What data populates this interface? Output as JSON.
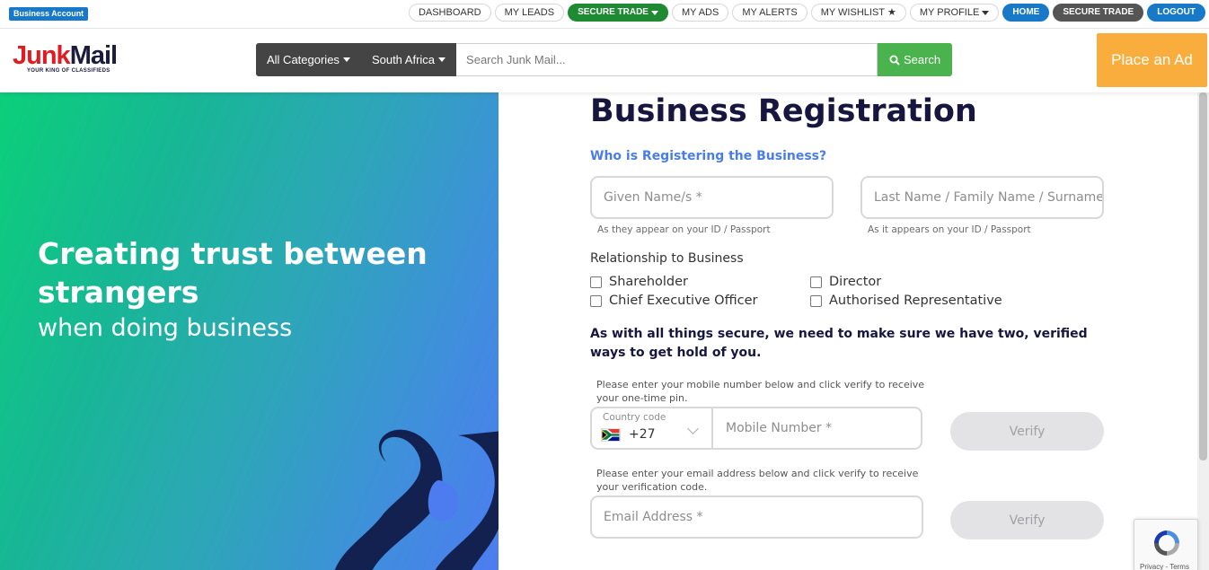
{
  "topbar": {
    "business_badge": "Business Account",
    "nav": [
      {
        "label": "DASHBOARD"
      },
      {
        "label": "MY LEADS"
      },
      {
        "label": "SECURE TRADE"
      },
      {
        "label": "MY ADS"
      },
      {
        "label": "MY ALERTS"
      },
      {
        "label": "MY WISHLIST"
      },
      {
        "label": "MY PROFILE"
      },
      {
        "label": "HOME"
      },
      {
        "label": "SECURE TRADE"
      },
      {
        "label": "LOGOUT"
      }
    ]
  },
  "header": {
    "logo_junk": "Junk",
    "logo_mail": "Mail",
    "logo_tagline": "YOUR KING OF CLASSIFIEDS",
    "category_select": "All Categories",
    "region_select": "South Africa",
    "search_placeholder": "Search Junk Mail...",
    "search_button": "Search",
    "place_ad": "Place an Ad"
  },
  "hero": {
    "headline": "Creating trust between strangers",
    "subline": "when doing business"
  },
  "form": {
    "title": "Business Registration",
    "who_heading": "Who is Registering the Business?",
    "given_name_placeholder": "Given Name/s *",
    "given_name_hint": "As they appear on your ID / Passport",
    "last_name_placeholder": "Last Name / Family Name / Surname *",
    "last_name_hint": "As it appears on your ID / Passport",
    "relationship_label": "Relationship to Business",
    "relationship_options": [
      {
        "label": "Shareholder",
        "checked": false
      },
      {
        "label": "Director",
        "checked": false
      },
      {
        "label": "Chief Executive Officer",
        "checked": false
      },
      {
        "label": "Authorised Representative",
        "checked": false
      }
    ],
    "secure_note": "As with all things secure, we need to make sure we have two, verified ways to get hold of you.",
    "mobile_note": "Please enter your mobile number below and click verify to receive your one-time pin.",
    "country_code_label": "Country code",
    "country_code_value": "+27",
    "mobile_placeholder": "Mobile Number *",
    "verify_mobile": "Verify",
    "email_note": "Please enter your email address below and click verify to receive your verification code.",
    "email_placeholder": "Email Address *",
    "verify_email": "Verify"
  },
  "recaptcha": {
    "links": "Privacy - Terms"
  },
  "colors": {
    "brand_red": "#e11b22",
    "brand_navy": "#16163f",
    "accent_blue": "#1779c7",
    "secure_green": "#1e8a31",
    "search_green": "#4bb34e",
    "place_ad_orange": "#f8ad3d"
  },
  "icons": [
    "caret-down-icon",
    "star-icon",
    "search-icon",
    "south-africa-flag-icon",
    "chevron-down-icon",
    "recaptcha-icon"
  ]
}
